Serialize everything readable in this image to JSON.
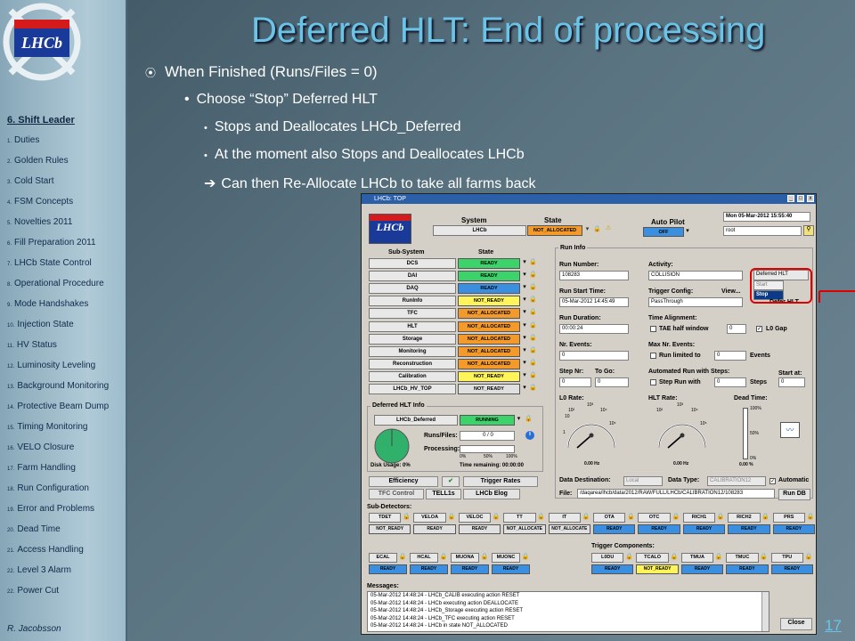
{
  "slide": {
    "title": "Deferred HLT: End of processing",
    "bullets": [
      "When Finished (Runs/Files = 0)",
      "Choose “Stop” Deferred HLT",
      "Stops and Deallocates LHCb_Deferred",
      "At the moment also Stops and Deallocates LHCb",
      "Can then Re-Allocate LHCb to take all farms back"
    ],
    "bullet_markers": [
      "⦿",
      "•",
      "•",
      "•",
      "➔"
    ],
    "page_number": "17",
    "author": "R. Jacobsson"
  },
  "sidebar": {
    "section": "6. Shift Leader",
    "items": [
      {
        "n": "1.",
        "label": "Duties"
      },
      {
        "n": "2.",
        "label": "Golden Rules"
      },
      {
        "n": "3.",
        "label": "Cold Start"
      },
      {
        "n": "4.",
        "label": "FSM Concepts"
      },
      {
        "n": "5.",
        "label": "Novelties 2011"
      },
      {
        "n": "6.",
        "label": "Fill Preparation 2011"
      },
      {
        "n": "7.",
        "label": "LHCb State Control"
      },
      {
        "n": "8.",
        "label": "Operational Procedure"
      },
      {
        "n": "9.",
        "label": "Mode Handshakes"
      },
      {
        "n": "10.",
        "label": "Injection State"
      },
      {
        "n": "11.",
        "label": "HV Status"
      },
      {
        "n": "12.",
        "label": "Luminosity Leveling"
      },
      {
        "n": "13.",
        "label": "Background Monitoring"
      },
      {
        "n": "14.",
        "label": "Protective Beam Dump"
      },
      {
        "n": "15.",
        "label": "Timing Monitoring"
      },
      {
        "n": "16.",
        "label": "VELO Closure"
      },
      {
        "n": "17.",
        "label": "Farm Handling"
      },
      {
        "n": "18.",
        "label": "Run Configuration"
      },
      {
        "n": "19.",
        "label": "Error and Problems"
      },
      {
        "n": "20.",
        "label": "Dead Time"
      },
      {
        "n": "21.",
        "label": "Access Handling"
      },
      {
        "n": "22.",
        "label": "Level 3 Alarm"
      },
      {
        "n": "22.",
        "label": "Power Cut"
      }
    ]
  },
  "panel": {
    "window_title": "LHCb: TOP",
    "logo_text": "LHCb",
    "system_label": "System",
    "state_label": "State",
    "system_value": "LHCb",
    "system_state": "NOT_ALLOCATED",
    "autopilot_label": "Auto Pilot",
    "autopilot_value": "OFF",
    "datetime": "Mon 05-Mar-2012  15:55:40",
    "user": "root",
    "subsystem_label": "Sub-System",
    "subsystems": [
      {
        "name": "DCS",
        "state": "READY",
        "color": "green"
      },
      {
        "name": "DAI",
        "state": "READY",
        "color": "green"
      },
      {
        "name": "DAQ",
        "state": "READY",
        "color": "blue"
      },
      {
        "name": "RunInfo",
        "state": "NOT_READY",
        "color": "yellow"
      },
      {
        "name": "TFC",
        "state": "NOT_ALLOCATED",
        "color": "orange"
      },
      {
        "name": "HLT",
        "state": "NOT_ALLOCATED",
        "color": "orange"
      },
      {
        "name": "Storage",
        "state": "NOT_ALLOCATED",
        "color": "orange"
      },
      {
        "name": "Monitoring",
        "state": "NOT_ALLOCATED",
        "color": "orange"
      },
      {
        "name": "Reconstruction",
        "state": "NOT_ALLOCATED",
        "color": "orange"
      },
      {
        "name": "Calibration",
        "state": "NOT_READY",
        "color": "yellow"
      },
      {
        "name": "LHCb_HV_TOP",
        "state": "NOT_READY",
        "color": "gray"
      }
    ],
    "runinfo": {
      "title": "Run Info",
      "run_number_label": "Run Number:",
      "run_number": "108283",
      "activity_label": "Activity:",
      "activity": "COLLISION",
      "deferred_select": "Deferred HLT",
      "menu_start": "Start",
      "menu_stop": "Stop",
      "defer_hlt": "Defer HLT",
      "start_time_label": "Run Start Time:",
      "start_time": "05-Mar-2012 14:45:49",
      "trigger_label": "Trigger Config:",
      "view": "View...",
      "trigger": "PassThrough",
      "duration_label": "Run Duration:",
      "duration": "00:00:24",
      "time_align_label": "Time Alignment:",
      "tae_label": "TAE half window",
      "tae_value": "0",
      "l0gap": "L0 Gap",
      "nr_events_label": "Nr. Events:",
      "nr_events": "0",
      "max_events_label": "Max Nr. Events:",
      "run_limited": "Run limited to",
      "max_events": "0",
      "events": "Events",
      "step_nr_label": "Step Nr:",
      "to_go_label": "To Go:",
      "step_nr": "0",
      "to_go": "0",
      "auto_steps_label": "Automated Run with Steps:",
      "step_run": "Step Run with",
      "steps_value": "0",
      "steps": "Steps",
      "start_at_label": "Start at:",
      "start_at": "0",
      "l0rate_label": "L0 Rate:",
      "l0rate": "0.00 Hz",
      "hltrate_label": "HLT Rate:",
      "hltrate": "0.00 Hz",
      "deadtime_label": "Dead Time:",
      "deadtime": "0.00 %",
      "dt_ticks": [
        "100%",
        "50%",
        "0%"
      ],
      "gauge_ticks": [
        "10²",
        "10³",
        "10⁴",
        "10⁵",
        "10",
        "1",
        "10⁶",
        "10⁷"
      ],
      "dest_label": "Data Destination:",
      "dest": "Local",
      "dtype_label": "Data Type:",
      "dtype": "CALIBRATION12",
      "automatic": "Automatic",
      "file_label": "File:",
      "file": "/daqarea/lhcb/data/2012/RAW/FULL/LHCb/CALIBRATION12/108283",
      "run_db": "Run DB"
    },
    "deferred": {
      "title": "Deferred HLT Info",
      "name": "LHCb_Deferred",
      "state": "RUNNING",
      "runs_files_label": "Runs/Files:",
      "runs_files": "0 / 0",
      "processing_label": "Processing:",
      "proc_ticks": [
        "0%",
        "50%",
        "100%"
      ],
      "disk_usage": "Disk Usage: 0%",
      "time_remaining": "Time remaining: 00:00:00",
      "processing_fraction": 0,
      "disk_fraction": 0
    },
    "buttons": {
      "efficiency": "Efficiency",
      "trigger_rates": "Trigger Rates",
      "tfc_control": "TFC Control",
      "tell1s": "TELL1s",
      "elog": "LHCb Elog",
      "close": "Close"
    },
    "subdetectors_label": "Sub-Detectors:",
    "subdet_row1": [
      {
        "name": "TDET",
        "state": "NOT_READY",
        "color": "gray"
      },
      {
        "name": "VELOA",
        "state": "READY",
        "color": "gray"
      },
      {
        "name": "VELOC",
        "state": "READY",
        "color": "gray"
      },
      {
        "name": "TT",
        "state": "NOT_ALLOCATE",
        "color": "gray"
      },
      {
        "name": "IT",
        "state": "NOT_ALLOCATE",
        "color": "gray"
      },
      {
        "name": "OTA",
        "state": "READY",
        "color": "blue"
      },
      {
        "name": "OTC",
        "state": "READY",
        "color": "blue"
      },
      {
        "name": "RICH1",
        "state": "READY",
        "color": "blue"
      },
      {
        "name": "RICH2",
        "state": "READY",
        "color": "blue"
      },
      {
        "name": "PRS",
        "state": "READY",
        "color": "blue"
      }
    ],
    "subdet_row2a": [
      {
        "name": "ECAL",
        "state": "READY",
        "color": "blue"
      },
      {
        "name": "HCAL",
        "state": "READY",
        "color": "blue"
      },
      {
        "name": "MUONA",
        "state": "READY",
        "color": "blue"
      },
      {
        "name": "MUONC",
        "state": "READY",
        "color": "blue"
      }
    ],
    "trigger_components_label": "Trigger Components:",
    "subdet_row2b": [
      {
        "name": "L0DU",
        "state": "READY",
        "color": "blue"
      },
      {
        "name": "TCALO",
        "state": "NOT_READY",
        "color": "yellow"
      },
      {
        "name": "TMUA",
        "state": "READY",
        "color": "blue"
      },
      {
        "name": "TMUC",
        "state": "READY",
        "color": "blue"
      },
      {
        "name": "TPU",
        "state": "READY",
        "color": "blue"
      }
    ],
    "messages_label": "Messages:",
    "messages": [
      "05-Mar-2012 14:48:24 - LHCb_CALIB executing action RESET",
      "05-Mar-2012 14:48:24 - LHCb executing action DEALLOCATE",
      "05-Mar-2012 14:48:24 - LHCb_Storage executing action RESET",
      "05-Mar-2012 14:48:24 - LHCb_TFC executing action RESET",
      "05-Mar-2012 14:48:24 - LHCb in state NOT_ALLOCATED"
    ]
  },
  "colors": {
    "title": "#6ac4e8",
    "green": "#3bd36a",
    "blue": "#3a8fe0",
    "yellow": "#fff45a",
    "orange": "#f39a2b",
    "highlight": "#e00000"
  }
}
